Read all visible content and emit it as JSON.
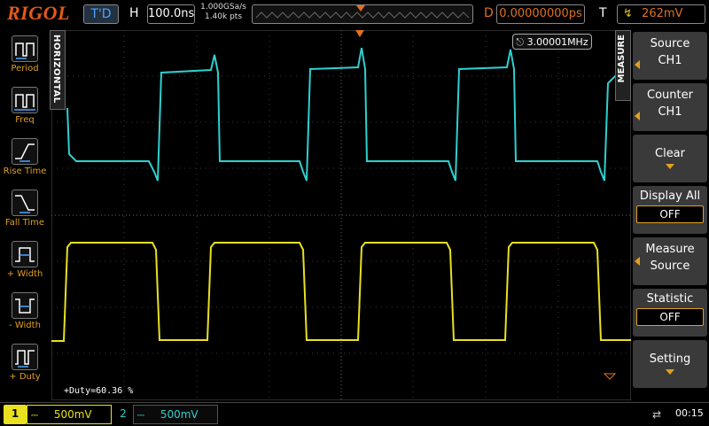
{
  "topbar": {
    "brand": "RIGOL",
    "run_state": "T'D",
    "h_label": "H",
    "timebase": "100.0ns",
    "sample_rate": "1.000GSa/s",
    "memory_depth": "1.40k pts",
    "d_label": "D",
    "delay": "0.00000000ps",
    "t_label": "T",
    "trigger_level": "262mV"
  },
  "left_menu": {
    "tab_label": "HORIZONTAL",
    "items": [
      {
        "label": "Period",
        "icon": "period-icon"
      },
      {
        "label": "Freq",
        "icon": "freq-icon"
      },
      {
        "label": "Rise Time",
        "icon": "rise-time-icon"
      },
      {
        "label": "Fall Time",
        "icon": "fall-time-icon"
      },
      {
        "label": "+ Width",
        "icon": "plus-width-icon"
      },
      {
        "label": "- Width",
        "icon": "minus-width-icon"
      },
      {
        "label": "+ Duty",
        "icon": "plus-duty-icon"
      }
    ]
  },
  "right_menu": {
    "tab_label": "MEASURE",
    "source_label": "Source",
    "source_value": "CH1",
    "counter_label": "Counter",
    "counter_value": "CH1",
    "clear_label": "Clear",
    "display_all_label": "Display All",
    "display_all_value": "OFF",
    "measure_source_line1": "Measure",
    "measure_source_line2": "Source",
    "statistic_label": "Statistic",
    "statistic_value": "OFF",
    "setting_label": "Setting"
  },
  "display": {
    "frequency": "3.00001MHz",
    "duty_readout": "+Duty=60.36 %"
  },
  "bottombar": {
    "ch1_number": "1",
    "ch1_scale": "500mV",
    "ch2_number": "2",
    "ch2_scale": "500mV",
    "time": "00:15"
  },
  "colors": {
    "ch1": "#e8e020",
    "ch2": "#2ed0d0",
    "accent": "#e07020"
  }
}
